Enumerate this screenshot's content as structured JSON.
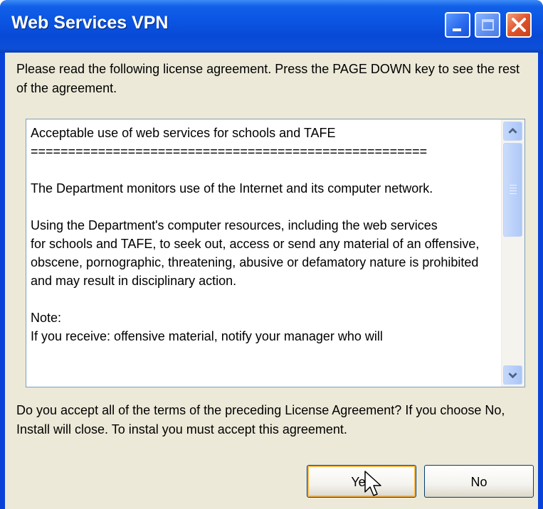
{
  "window": {
    "title": "Web Services VPN",
    "controls": [
      "minimize",
      "maximize",
      "close"
    ]
  },
  "intro_text": "Please read the following license agreement. Press the PAGE DOWN key to see the rest of the agreement.",
  "license_text": "Acceptable use of web services for schools and TAFE\n=====================================================\n\nThe Department monitors use of the Internet and its computer network.\n\nUsing the Department's computer resources, including the web services\nfor schools and TAFE, to seek out, access or send any material of an offensive, obscene, pornographic, threatening, abusive or defamatory nature is prohibited and may result in disciplinary action.\n\nNote:\nIf you receive: offensive material, notify your manager who will",
  "question_text": "Do you accept all of the terms of the preceding License Agreement? If you choose No, Install will close. To instal you must accept this agreement.",
  "buttons": {
    "yes": "Yes",
    "no": "No"
  },
  "colors": {
    "titlebar": "#0a55e2",
    "client": "#ece9d8",
    "close_button": "#e0542c"
  }
}
